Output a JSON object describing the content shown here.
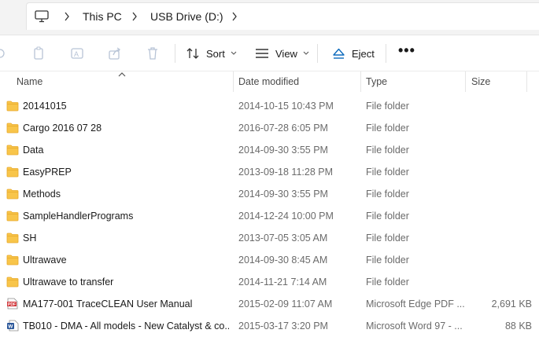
{
  "breadcrumb": {
    "items": [
      "This PC",
      "USB Drive (D:)"
    ]
  },
  "toolbar": {
    "sort_label": "Sort",
    "view_label": "View",
    "eject_label": "Eject",
    "more_label": "•••"
  },
  "columns": {
    "name": "Name",
    "date": "Date modified",
    "type": "Type",
    "size": "Size"
  },
  "files": [
    {
      "name": "20141015",
      "date": "2014-10-15 10:43 PM",
      "type": "File folder",
      "size": "",
      "icon": "folder-icon"
    },
    {
      "name": "Cargo 2016 07 28",
      "date": "2016-07-28 6:05 PM",
      "type": "File folder",
      "size": "",
      "icon": "folder-icon"
    },
    {
      "name": "Data",
      "date": "2014-09-30 3:55 PM",
      "type": "File folder",
      "size": "",
      "icon": "folder-icon"
    },
    {
      "name": "EasyPREP",
      "date": "2013-09-18 11:28 PM",
      "type": "File folder",
      "size": "",
      "icon": "folder-icon"
    },
    {
      "name": "Methods",
      "date": "2014-09-30 3:55 PM",
      "type": "File folder",
      "size": "",
      "icon": "folder-icon"
    },
    {
      "name": "SampleHandlerPrograms",
      "date": "2014-12-24 10:00 PM",
      "type": "File folder",
      "size": "",
      "icon": "folder-icon"
    },
    {
      "name": "SH",
      "date": "2013-07-05 3:05 AM",
      "type": "File folder",
      "size": "",
      "icon": "folder-icon"
    },
    {
      "name": "Ultrawave",
      "date": "2014-09-30 8:45 AM",
      "type": "File folder",
      "size": "",
      "icon": "folder-icon"
    },
    {
      "name": "Ultrawave to transfer",
      "date": "2014-11-21 7:14 AM",
      "type": "File folder",
      "size": "",
      "icon": "folder-icon"
    },
    {
      "name": "MA177-001 TraceCLEAN User Manual",
      "date": "2015-02-09 11:07 AM",
      "type": "Microsoft Edge PDF ...",
      "size": "2,691 KB",
      "icon": "pdf-icon"
    },
    {
      "name": "TB010 - DMA - All models - New Catalyst & co...",
      "date": "2015-03-17 3:20 PM",
      "type": "Microsoft Word 97 - ...",
      "size": "88 KB",
      "icon": "word-doc-icon"
    }
  ],
  "colors": {
    "folder": "#f8c54a",
    "folder_dark": "#e8a92a",
    "pdf": "#d13438",
    "word": "#2b579a",
    "eject": "#0f6cbd"
  }
}
